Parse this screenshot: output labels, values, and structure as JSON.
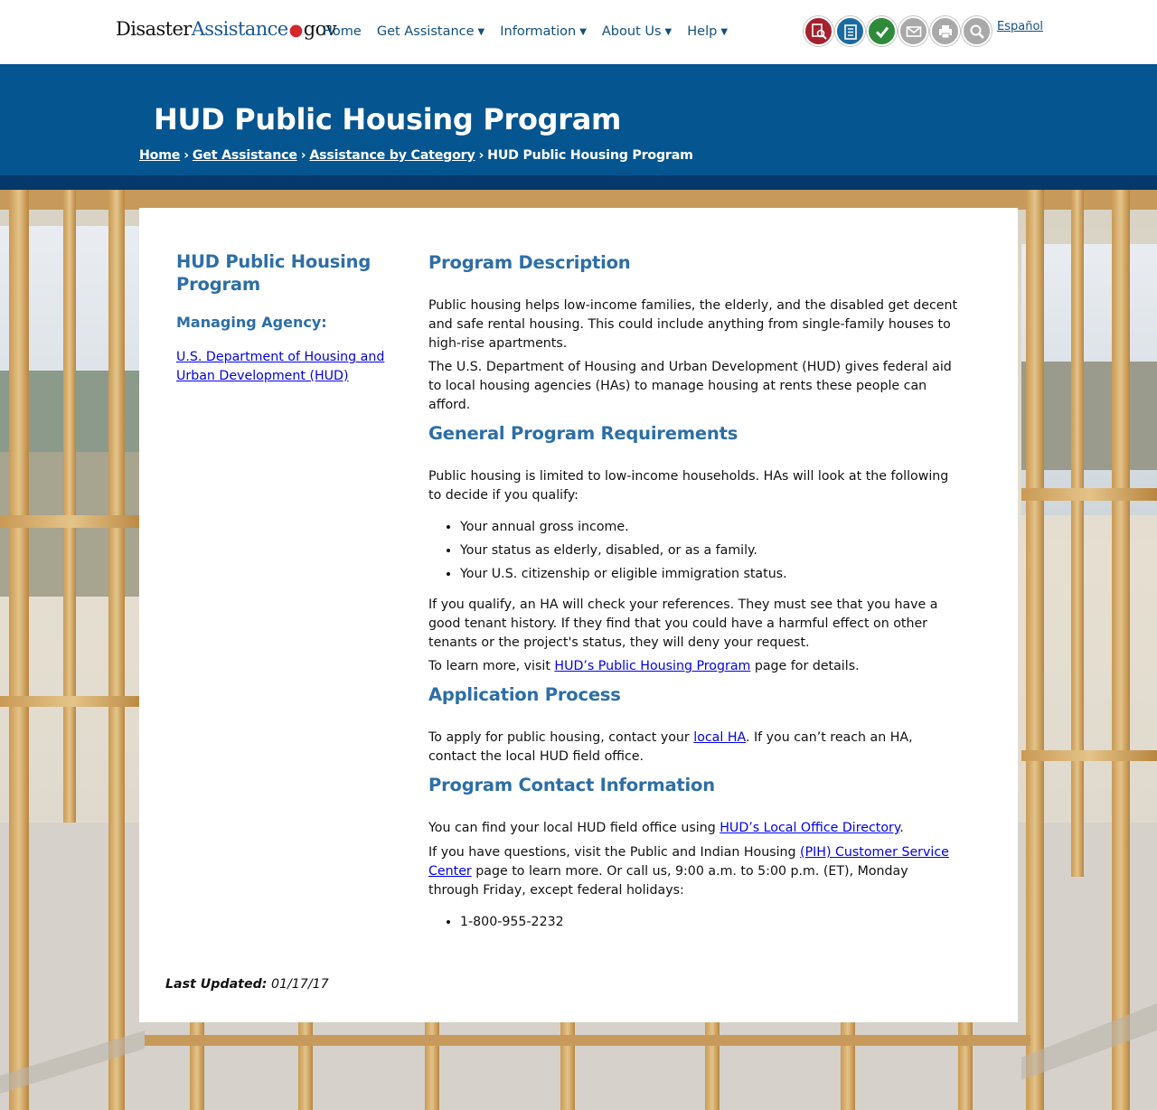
{
  "site": {
    "logo_part1": "Disaster",
    "logo_part2": "Assistance",
    "logo_dot": "●",
    "logo_part3": "gov"
  },
  "nav": [
    {
      "label": "Home",
      "has_menu": false
    },
    {
      "label": "Get Assistance",
      "has_menu": true
    },
    {
      "label": "Information",
      "has_menu": true
    },
    {
      "label": "About Us",
      "has_menu": true
    },
    {
      "label": "Help",
      "has_menu": true
    }
  ],
  "tools": [
    {
      "icon": "find-assistance-icon",
      "color": "#a4222d"
    },
    {
      "icon": "checklist-icon",
      "color": "#1d6b9e"
    },
    {
      "icon": "check-status-icon",
      "color": "#2e8b3a"
    },
    {
      "icon": "email-icon",
      "color": "#a9a9a9"
    },
    {
      "icon": "print-icon",
      "color": "#a9a9a9"
    },
    {
      "icon": "search-icon",
      "color": "#a9a9a9"
    }
  ],
  "language_link": "Español",
  "header": {
    "title": "HUD Public Housing Program",
    "breadcrumb": [
      "Home",
      "Get Assistance",
      "Assistance by Category",
      "HUD Public Housing Program"
    ],
    "separator": "›"
  },
  "sidebar": {
    "title": "HUD Public Housing Program",
    "agency_label": "Managing Agency:",
    "agency_link": "U.S. Department of Housing and Urban Development (HUD)"
  },
  "sections": {
    "description": {
      "heading": "Program Description",
      "p1": "Public housing helps low-income families, the elderly, and the disabled get decent and safe rental housing. This could include anything from single-family houses to high-rise apartments.",
      "p2": "The U.S. Department of Housing and Urban Development (HUD) gives federal aid to local housing agencies (HAs) to manage housing at rents these people can afford."
    },
    "requirements": {
      "heading": "General Program Requirements",
      "p1": "Public housing is limited to low-income households. HAs will look at the following to decide if you qualify:",
      "items": [
        "Your annual gross income.",
        "Your status as elderly, disabled, or as a family.",
        "Your U.S. citizenship or eligible immigration status."
      ],
      "p2": "If you qualify, an HA will check your references. They must see that you have a good tenant history. If they find that you could have a harmful effect on other tenants or the project's status, they will deny your request.",
      "p3_before": "To learn more, visit ",
      "p3_link": "HUD’s Public Housing Program",
      "p3_after": " page for details."
    },
    "application": {
      "heading": "Application Process",
      "p1_before": "To apply for public housing, contact your ",
      "p1_link": "local HA",
      "p1_after": ". If you can’t reach an HA, contact the local HUD field office."
    },
    "contact": {
      "heading": "Program Contact Information",
      "p1_before": "You can find your local HUD field office using ",
      "p1_link": "HUD’s Local Office Directory",
      "p1_after": ".",
      "p2_before": "If you have questions, visit the Public and Indian Housing ",
      "p2_link": "(PIH) Customer Service Center",
      "p2_after": " page to learn more. Or call us, 9:00 a.m. to 5:00 p.m. (ET), Monday through Friday, except federal holidays:",
      "phones": [
        "1-800-955-2232"
      ]
    }
  },
  "footer": {
    "last_updated_label": "Last Updated:",
    "last_updated_value": "01/17/17"
  }
}
